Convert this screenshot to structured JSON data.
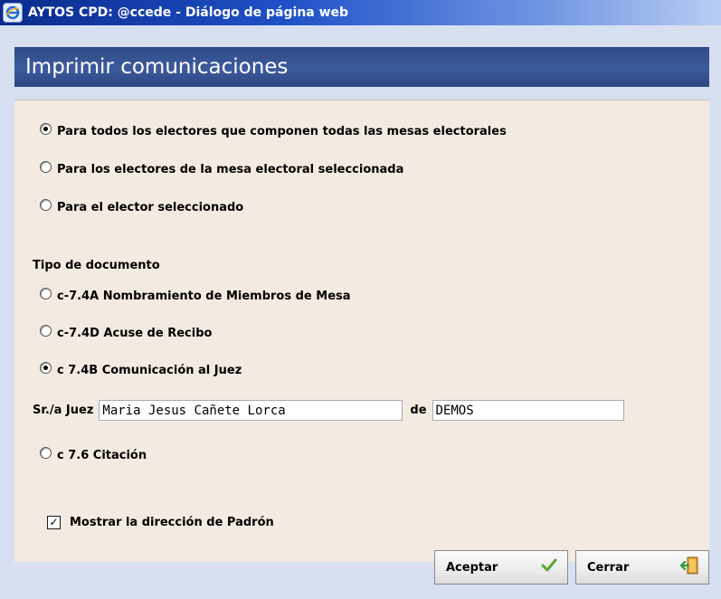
{
  "window": {
    "title": "AYTOS CPD: @ccede - Diálogo de página web",
    "icon": "ie-browser-icon"
  },
  "header": {
    "title": "Imprimir comunicaciones"
  },
  "scope_options": [
    {
      "label": "Para todos los electores que componen todas las mesas electorales",
      "selected": true
    },
    {
      "label": "Para los electores de la mesa electoral seleccionada",
      "selected": false
    },
    {
      "label": "Para el elector seleccionado",
      "selected": false
    }
  ],
  "document_type": {
    "label": "Tipo de documento",
    "options": [
      {
        "label": "c-7.4A Nombramiento de Miembros de Mesa",
        "selected": false
      },
      {
        "label": "c-7.4D Acuse de Recibo",
        "selected": false
      },
      {
        "label": "c 7.4B Comunicación al Juez",
        "selected": true
      },
      {
        "label": "c 7.6 Citación",
        "selected": false
      }
    ]
  },
  "judge": {
    "label": "Sr./a Juez",
    "name_value": "Maria Jesus Cañete Lorca",
    "of_label": "de",
    "place_value": "DEMOS"
  },
  "show_address": {
    "label": "Mostrar la dirección de Padrón",
    "checked": true
  },
  "buttons": {
    "accept": {
      "label": "Aceptar",
      "icon": "checkmark-icon"
    },
    "close": {
      "label": "Cerrar",
      "icon": "exit-door-icon"
    }
  },
  "colors": {
    "header_bg": "#3a5898",
    "panel_bg": "#f3ebe2",
    "dialog_bg": "#d6e0f0",
    "accept_icon": "#5aa832"
  }
}
